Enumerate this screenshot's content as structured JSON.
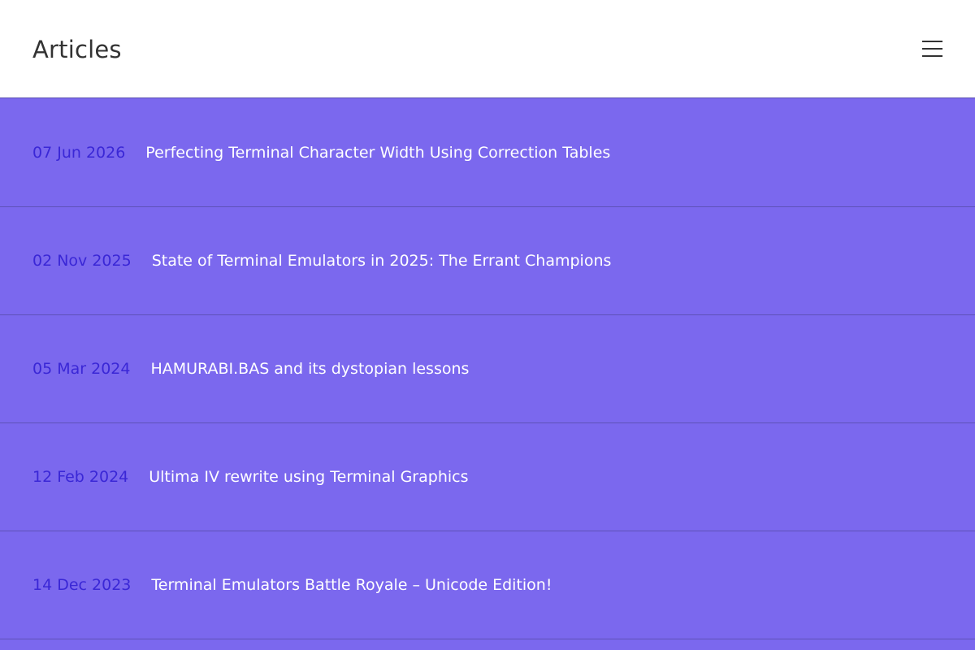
{
  "header": {
    "title": "Articles",
    "menu_icon": "hamburger-menu-icon"
  },
  "articles": [
    {
      "date": "07 Jun 2026",
      "title": "Perfecting Terminal Character Width Using Correction Tables"
    },
    {
      "date": "02 Nov 2025",
      "title": "State of Terminal Emulators in 2025: The Errant Champions"
    },
    {
      "date": "05 Mar 2024",
      "title": "HAMURABI.BAS and its dystopian lessons"
    },
    {
      "date": "12 Feb 2024",
      "title": "Ultima IV rewrite using Terminal Graphics"
    },
    {
      "date": "14 Dec 2023",
      "title": "Terminal Emulators Battle Royale – Unicode Edition!"
    }
  ],
  "colors": {
    "background": "#7b68ee",
    "header_background": "#ffffff",
    "date_text": "#3a27d6",
    "title_text": "#ffffff"
  }
}
